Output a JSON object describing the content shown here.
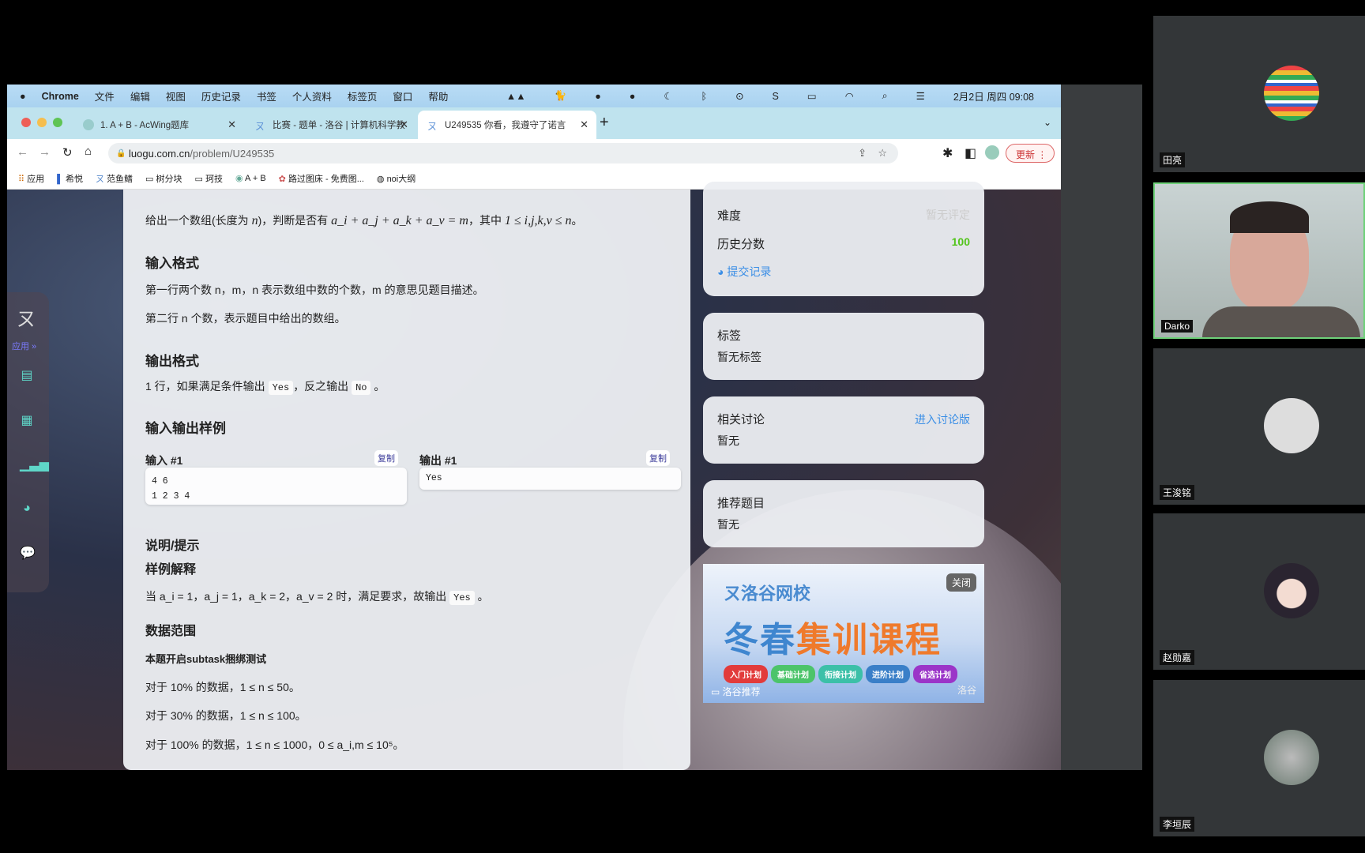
{
  "menubar": {
    "app": "Chrome",
    "items": [
      "文件",
      "编辑",
      "视图",
      "历史记录",
      "书签",
      "个人资料",
      "标签页",
      "窗口",
      "帮助"
    ],
    "clock": "2月2日 周四  09:08"
  },
  "tabs": [
    {
      "title": "1. A + B - AcWing题库"
    },
    {
      "title": "比赛 - 题单 - 洛谷 | 计算机科学教"
    },
    {
      "title": "U249535 你看，我遵守了诺言",
      "active": true
    }
  ],
  "address": {
    "host": "luogu.com.cn",
    "path": "/problem/U249535",
    "update_label": "更新"
  },
  "bookmarks": [
    "应用",
    "希悦",
    "范鱼鳍",
    "树分块",
    "珂技",
    "A + B",
    "路过图床 - 免费图...",
    "noi大纲"
  ],
  "sidebar": {
    "apps_label": "应用 »",
    "icons": [
      "problem-list-icon",
      "clipboard-icon",
      "ranking-icon",
      "record-icon",
      "discussion-icon"
    ]
  },
  "problem": {
    "desc_prefix": "给出一个数组(长度为 ",
    "desc_n": "n",
    "desc_mid": ")，判断是否有 ",
    "desc_eq": "a_i + a_j + a_k + a_v = m",
    "desc_mid2": "，其中 ",
    "desc_range": "1 ≤ i,j,k,v ≤ n",
    "desc_end": "。",
    "input_heading": "输入格式",
    "input_line1": "第一行两个数 n，m，n 表示数组中数的个数，m 的意思见题目描述。",
    "input_line2": "第二行 n 个数，表示题目中给出的数组。",
    "output_heading": "输出格式",
    "output_line_a": "1 行，如果满足条件输出 ",
    "output_yes": "Yes",
    "output_line_b": "，反之输出 ",
    "output_no": "No",
    "output_line_c": " 。",
    "samples_heading": "输入输出样例",
    "sample_in_label": "输入 #1",
    "sample_out_label": "输出 #1",
    "copy_label": "复制",
    "sample_in": "4 6\n1 2 3 4",
    "sample_out": "Yes",
    "hint_heading": "说明/提示",
    "explain_heading": "样例解释",
    "explain_line": "当 a_i = 1，a_j = 1，a_k = 2，a_v = 2 时，满足要求，故输出 ",
    "explain_yes": "Yes",
    "explain_end": " 。",
    "range_heading": "数据范围",
    "subtask": "本题开启subtask捆绑测试",
    "range1": "对于 10% 的数据，1 ≤ n ≤ 50。",
    "range2": "对于 30% 的数据，1 ≤ n ≤ 100。",
    "range3": "对于 100% 的数据，1 ≤ n ≤ 1000，0 ≤ a_i,m ≤ 10⁵。"
  },
  "info": {
    "difficulty_label": "难度",
    "difficulty_value": "暂无评定",
    "score_label": "历史分数",
    "score_value": "100",
    "score_color": "#52c41a",
    "records_link": "提交记录"
  },
  "tags": {
    "title": "标签",
    "value": "暂无标签"
  },
  "discuss": {
    "title": "相关讨论",
    "link": "进入讨论版",
    "value": "暂无"
  },
  "recommend": {
    "title": "推荐题目",
    "value": "暂无"
  },
  "ad": {
    "brand": "洛谷网校",
    "headline_blue": "冬春",
    "headline_orange": "集训课程",
    "close": "关闭",
    "plans": [
      "入门计划",
      "基础计划",
      "衔接计划",
      "进阶计划",
      "省选计划"
    ],
    "footer": "洛谷推荐",
    "watermark": "洛谷"
  },
  "participants": [
    {
      "name": "田亮"
    },
    {
      "name": "Darko",
      "speaking": true
    },
    {
      "name": "王浚铭"
    },
    {
      "name": "赵勋嘉"
    },
    {
      "name": "李垣辰"
    }
  ]
}
